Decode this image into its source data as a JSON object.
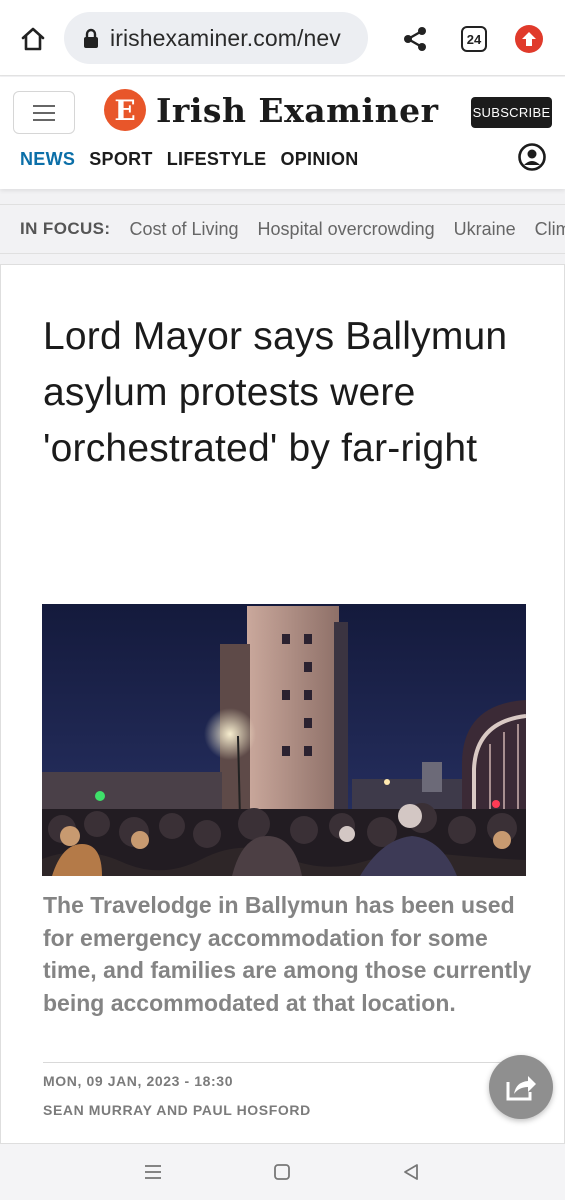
{
  "browser": {
    "url": "irishexaminer.com/nev",
    "tab_count": "24",
    "icons": {
      "home": "home-icon",
      "lock": "lock-icon",
      "share": "share-icon",
      "tabs": "tabs-icon",
      "opera": "opera-upload-icon"
    }
  },
  "site": {
    "logo_mark": "E",
    "logo_text": "Irish Examiner",
    "subscribe_label": "SUBSCRIBE",
    "brand_color": "#e8562a",
    "nav": [
      {
        "label": "NEWS",
        "active": true
      },
      {
        "label": "SPORT",
        "active": false
      },
      {
        "label": "LIFESTYLE",
        "active": false
      },
      {
        "label": "OPINION",
        "active": false
      }
    ],
    "nav_active_color": "#0b6fa8"
  },
  "in_focus": {
    "label": "IN FOCUS:",
    "items": [
      "Cost of Living",
      "Hospital overcrowding",
      "Ukraine",
      "Clima"
    ]
  },
  "article": {
    "headline": "Lord Mayor says Ballymun asylum protests were 'orchestrated' by far-right",
    "standfirst": "The Travelodge in Ballymun has been used for emergency accommodation for some time, and families are among those currently being accommodated at that location.",
    "date": "MON, 09 JAN, 2023 - 18:30",
    "byline": "SEAN MURRAY AND PAUL HOSFORD"
  }
}
